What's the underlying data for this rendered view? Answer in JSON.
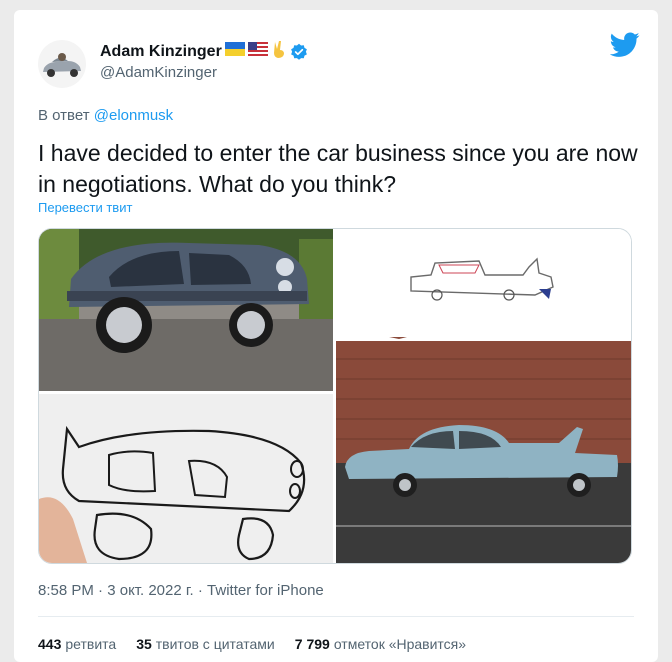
{
  "author": {
    "display_name": "Adam Kinzinger",
    "handle": "@AdamKinzinger",
    "verified": true,
    "name_emojis": [
      "ukraine-flag",
      "us-flag",
      "victory-hand"
    ]
  },
  "reply": {
    "prefix": "В ответ",
    "mention": "@elonmusk"
  },
  "tweet": {
    "text": "I have decided to enter the car business since you are now in negotiations.  What do you think?",
    "translate_label": "Перевести твит"
  },
  "media": {
    "count": 4,
    "descriptions": [
      "car-photo-top-left",
      "car-drawing-top-right",
      "car-drawing-bottom-left",
      "car-photo-bottom-right"
    ]
  },
  "meta": {
    "time": "8:58 PM",
    "date": "3 окт. 2022 г.",
    "source": "Twitter for iPhone"
  },
  "stats": {
    "retweets_value": "443",
    "retweets_label": "ретвита",
    "quotes_value": "35",
    "quotes_label": "твитов с цитатами",
    "likes_value": "7 799",
    "likes_label": "отметок «Нравится»"
  },
  "colors": {
    "accent": "#1d9bf0",
    "text": "#0f1419",
    "muted": "#536471"
  }
}
